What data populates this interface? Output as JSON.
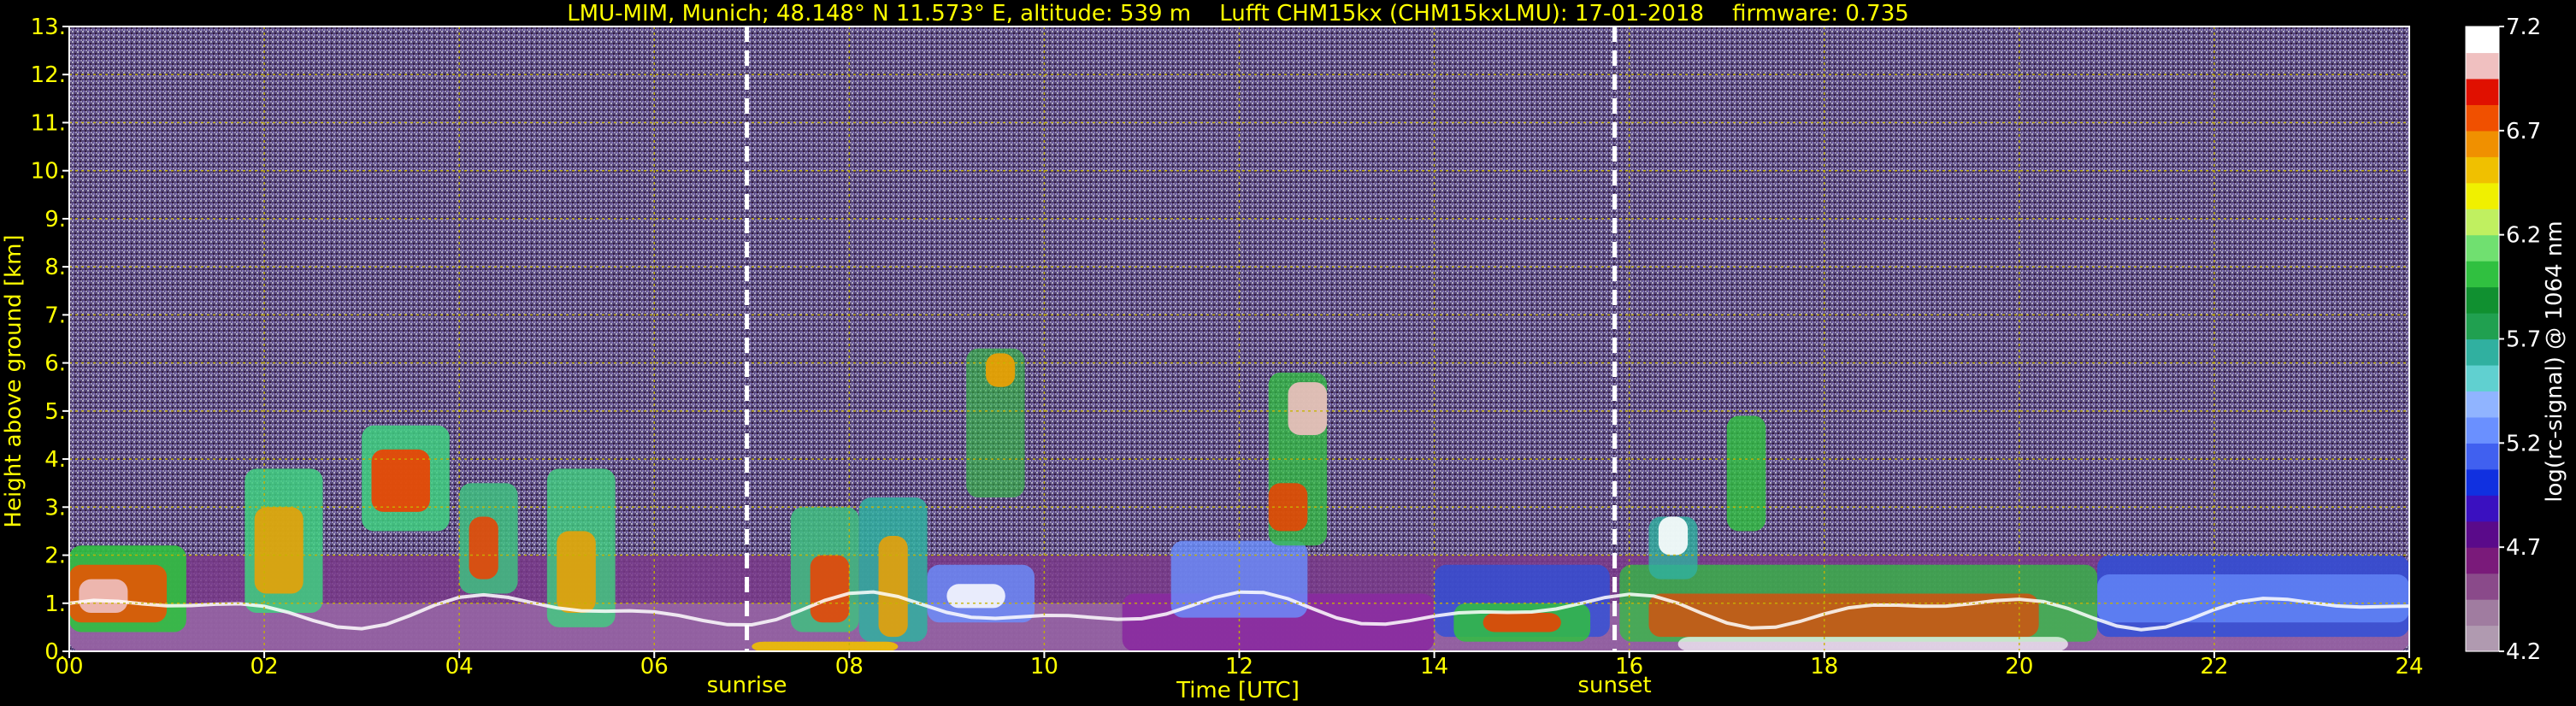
{
  "chart_data": {
    "type": "heatmap",
    "title": "LMU-MIM, Munich; 48.148° N 11.573° E, altitude: 539 m    Lufft CHM15kx (CHM15kxLMU): 17-01-2018    firmware: 0.735",
    "xlabel": "Time [UTC]",
    "ylabel": "Height above ground [km]",
    "xlim": [
      0,
      24
    ],
    "ylim": [
      0,
      13
    ],
    "x_ticks": [
      "00",
      "02",
      "04",
      "06",
      "08",
      "10",
      "12",
      "14",
      "16",
      "18",
      "20",
      "22",
      "24"
    ],
    "x_tick_values": [
      0,
      2,
      4,
      6,
      8,
      10,
      12,
      14,
      16,
      18,
      20,
      22,
      24
    ],
    "y_ticks": [
      "0.",
      "1.",
      "2.",
      "3.",
      "4.",
      "5.",
      "6.",
      "7.",
      "8.",
      "9.",
      "10.",
      "11.",
      "12.",
      "13."
    ],
    "y_tick_values": [
      0,
      1,
      2,
      3,
      4,
      5,
      6,
      7,
      8,
      9,
      10,
      11,
      12,
      13
    ],
    "grid": true,
    "annotations": [
      {
        "label": "sunrise",
        "x": 6.95
      },
      {
        "label": "sunset",
        "x": 15.85
      }
    ],
    "colorbar": {
      "label": "log(rc-signal) @ 1064 nm",
      "range": [
        4.2,
        7.2
      ],
      "ticks": [
        "4.2",
        "4.7",
        "5.2",
        "5.7",
        "6.2",
        "6.7",
        "7.2"
      ],
      "tick_values": [
        4.2,
        4.7,
        5.2,
        5.7,
        6.2,
        6.7,
        7.2
      ],
      "colors": [
        "#b09ab0",
        "#a07ca0",
        "#8a4a8a",
        "#7a1a7a",
        "#5a0a8a",
        "#3a10c0",
        "#1030e0",
        "#4060f0",
        "#6a90ff",
        "#90b4ff",
        "#60d0d0",
        "#30b0a0",
        "#20a050",
        "#109030",
        "#30c040",
        "#70e070",
        "#c0f060",
        "#f0f000",
        "#f0c000",
        "#f09000",
        "#f05000",
        "#e01000",
        "#f0c0c0",
        "#ffffff"
      ]
    },
    "layers": [
      {
        "name": "cloud-low-red",
        "x_range": [
          0,
          24
        ],
        "height_km": [
          0.2,
          1.0
        ]
      },
      {
        "name": "boundary-layer",
        "x_range": [
          0,
          24
        ],
        "height_km": [
          0,
          2.0
        ]
      }
    ]
  }
}
